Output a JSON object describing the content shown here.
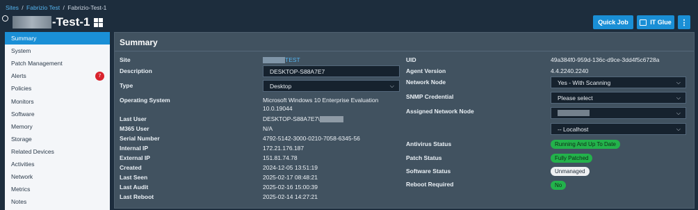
{
  "breadcrumb": {
    "sites": "Sites",
    "sep": "/",
    "customer": "Fabrizio Test",
    "device": "Fabrizio-Test-1"
  },
  "title": {
    "suffix": "-Test-1"
  },
  "actions": {
    "quick_job": "Quick Job",
    "it_glue": "IT Glue",
    "more": "⋮"
  },
  "sidebar": {
    "items": [
      {
        "label": "Summary",
        "active": true
      },
      {
        "label": "System"
      },
      {
        "label": "Patch Management"
      },
      {
        "label": "Alerts",
        "badge": "7"
      },
      {
        "label": "Policies"
      },
      {
        "label": "Monitors"
      },
      {
        "label": "Software"
      },
      {
        "label": "Memory"
      },
      {
        "label": "Storage"
      },
      {
        "label": "Related Devices"
      },
      {
        "label": "Activities"
      },
      {
        "label": "Network"
      },
      {
        "label": "Metrics"
      },
      {
        "label": "Notes"
      }
    ]
  },
  "summary": {
    "title": "Summary",
    "labels": {
      "site": "Site",
      "description": "Description",
      "type": "Type",
      "os": "Operating System",
      "last_user": "Last User",
      "m365_user": "M365 User",
      "serial": "Serial Number",
      "internal_ip": "Internal IP",
      "external_ip": "External IP",
      "created": "Created",
      "last_seen": "Last Seen",
      "last_audit": "Last Audit",
      "last_reboot": "Last Reboot",
      "uid": "UID",
      "agent_version": "Agent Version",
      "network_node": "Network Node",
      "snmp_credential": "SNMP Credential",
      "assigned_network_node": "Assigned Network Node",
      "antivirus_status": "Antivirus Status",
      "patch_status": "Patch Status",
      "software_status": "Software Status",
      "reboot_required": "Reboot Required"
    },
    "values": {
      "site_suffix": "TEST",
      "description": "DESKTOP-S88A7E7",
      "type": "Desktop",
      "os_line1": "Microsoft Windows 10 Enterprise Evaluation",
      "os_line2": "10.0.19044",
      "last_user": "DESKTOP-S88A7E7\\",
      "m365_user": "N/A",
      "serial": "4792-5142-3000-0210-7058-6345-56",
      "internal_ip": "172.21.176.187",
      "external_ip": "151.81.74.78",
      "created": "2024-12-05 13:51:19",
      "last_seen": "2025-02-17 08:48:21",
      "last_audit": "2025-02-16 15:00:39",
      "last_reboot": "2025-02-14 14:27:21",
      "uid": "49a384f0-959d-136c-d9ce-3dd4f5c6728a",
      "agent_version": "4.4.2240.2240",
      "network_node": "Yes - With Scanning",
      "snmp_credential": "Please select",
      "localhost": "-- Localhost",
      "antivirus_status": "Running And Up To Date",
      "patch_status": "Fully Patched",
      "software_status": "Unmanaged",
      "reboot_required": "No"
    }
  },
  "colors": {
    "accent": "#1a8fd6",
    "ok": "#23b24b",
    "alert": "#d9232d",
    "background": "#1d2d3d",
    "panel": "#415260"
  }
}
